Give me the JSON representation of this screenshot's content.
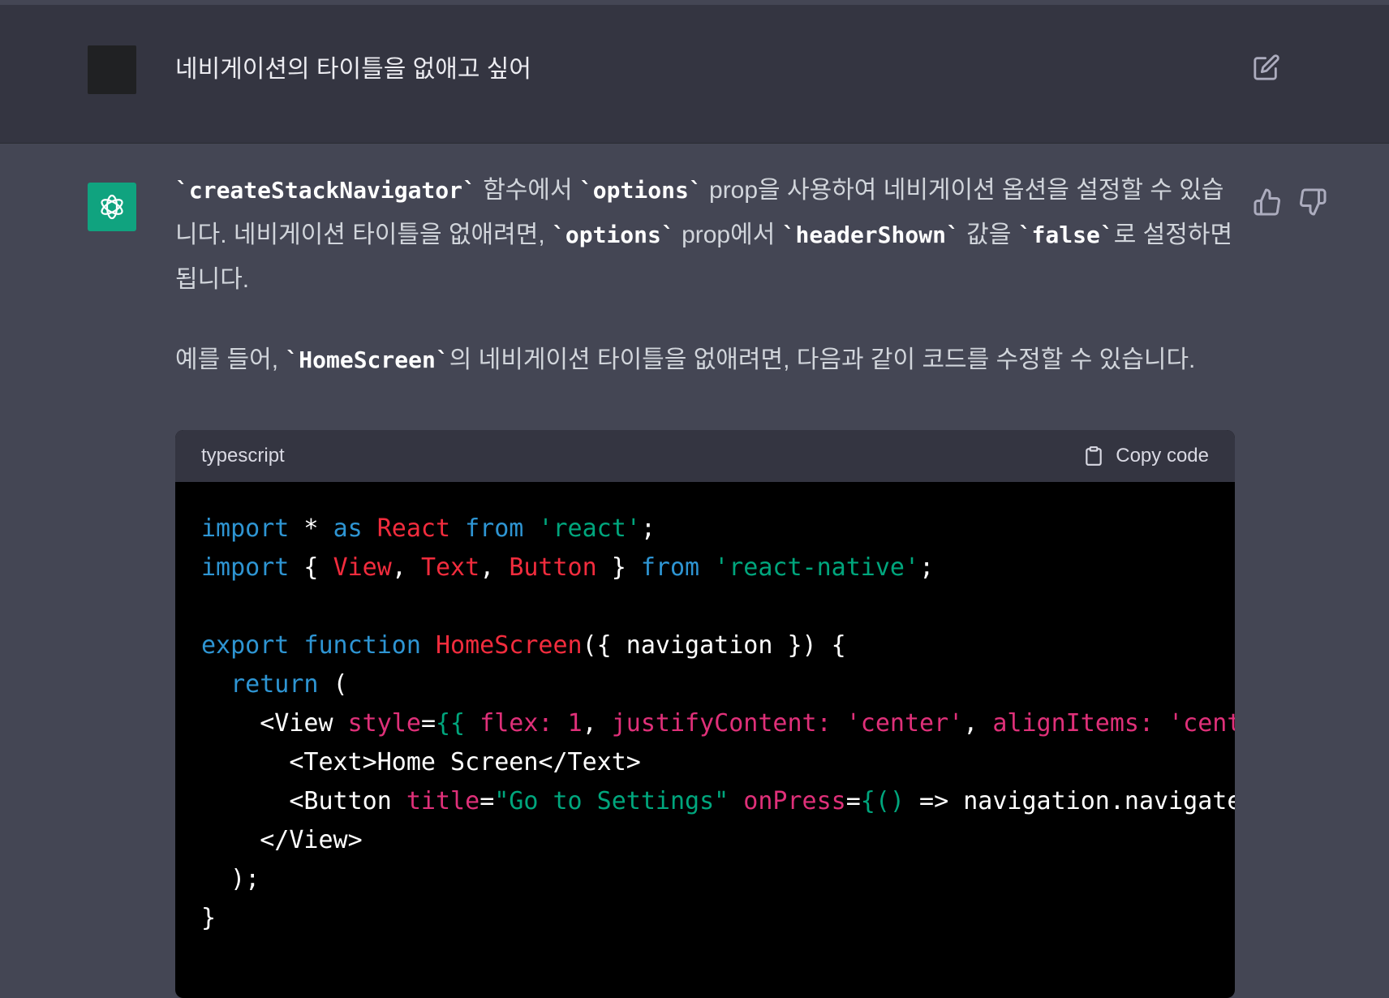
{
  "user": {
    "message": "네비게이션의 타이틀을 없애고 싶어"
  },
  "assistant": {
    "p1": {
      "c1": "`createStackNavigator`",
      "t1": " 함수에서 ",
      "c2": "`options`",
      "t2": " prop을 사용하여 네비게이션 옵션을 설정할 수 있습니다. 네비게이션 타이틀을 없애려면, ",
      "c3": "`options`",
      "t3": " prop에서 ",
      "c4": "`headerShown`",
      "t4": " 값을 ",
      "c5": "`false`",
      "t5": "로 설정하면 됩니다."
    },
    "p2": {
      "t1": "예를 들어, ",
      "c1": "`HomeScreen`",
      "t2": "의 네비게이션 타이틀을 없애려면, 다음과 같이 코드를 수정할 수 있습니다."
    }
  },
  "code_block": {
    "language": "typescript",
    "copy_label": "Copy code",
    "tokens": {
      "l1": [
        "import",
        " * ",
        "as",
        " ",
        "React",
        " ",
        "from",
        " ",
        "'react'",
        ";"
      ],
      "l2": [
        "import",
        " { ",
        "View",
        ", ",
        "Text",
        ", ",
        "Button",
        " } ",
        "from",
        " ",
        "'react-native'",
        ";"
      ],
      "l4": [
        "export",
        " ",
        "function",
        " ",
        "HomeScreen",
        "({ navigation }) {"
      ],
      "l5": [
        "  ",
        "return",
        " ("
      ],
      "l6": [
        "    <View ",
        "style",
        "=",
        "{{ ",
        "flex:",
        " ",
        "1",
        ", ",
        "justifyContent:",
        " ",
        "'center'",
        ", ",
        "alignItems:",
        " ",
        "'center'",
        " }"
      ],
      "l7": [
        "      <Text>Home Screen</Text>"
      ],
      "l8": [
        "      <Button ",
        "title",
        "=",
        "\"Go to Settings\"",
        " ",
        "onPress",
        "=",
        "{()",
        " => navigation.navigate('Set"
      ],
      "l9": [
        "    </View>"
      ],
      "l10": [
        "  );"
      ],
      "l11": [
        "}"
      ]
    }
  },
  "colors": {
    "keyword": "#2e95d3",
    "type": "#f22c3d",
    "string": "#00a67d",
    "attribute": "#df3079",
    "accent": "#10a37f"
  },
  "icons": {
    "edit": "edit-icon",
    "logo": "openai-logo-icon",
    "like": "thumbs-up-icon",
    "dislike": "thumbs-down-icon",
    "copy": "clipboard-icon"
  }
}
